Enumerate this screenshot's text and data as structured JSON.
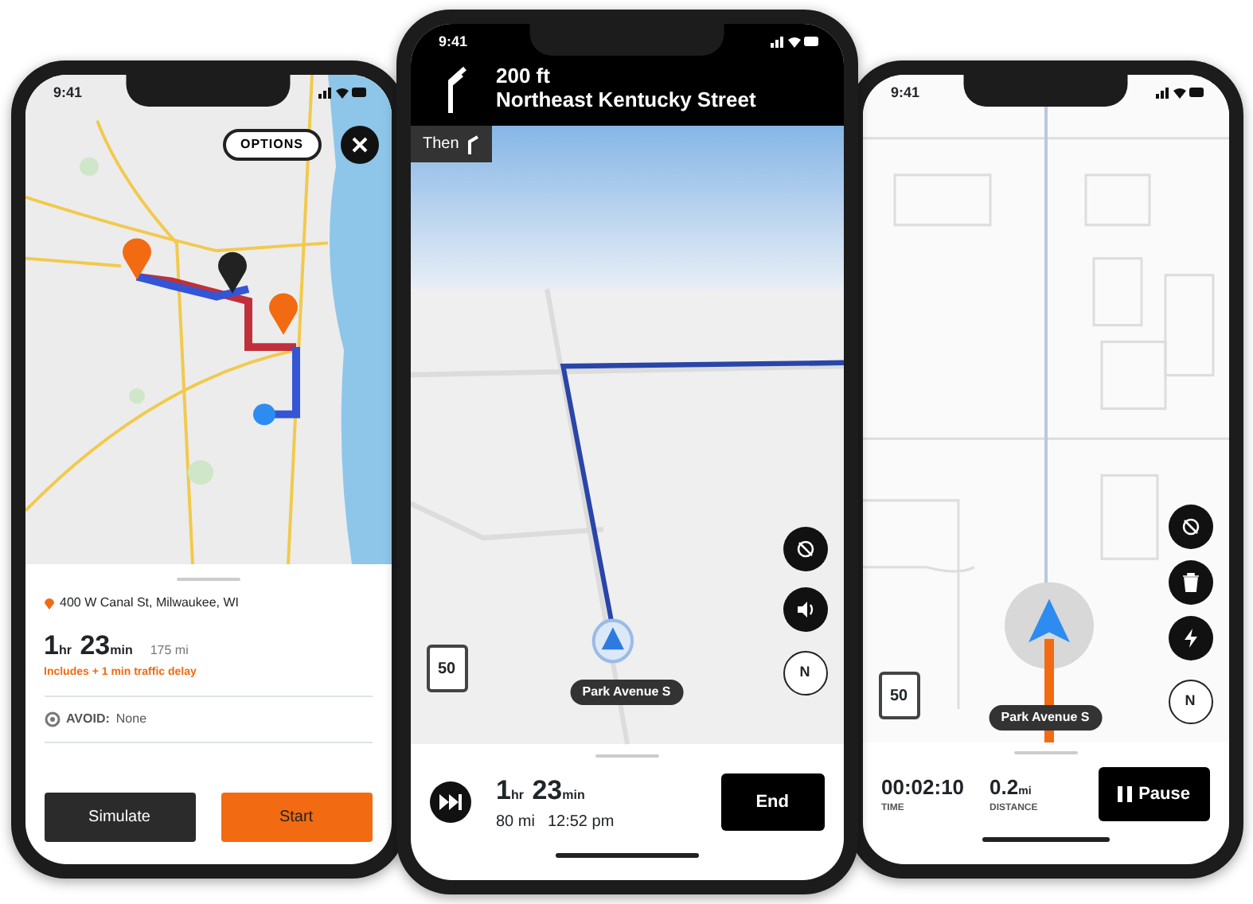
{
  "phones": [
    {
      "kind": "route_preview",
      "status_time": "9:41",
      "options_label": "OPTIONS",
      "address": "400 W Canal St, Milwaukee, WI",
      "duration": {
        "hours": "1",
        "hours_unit": "hr",
        "minutes": "23",
        "minutes_unit": "min"
      },
      "distance": "175 mi",
      "traffic_note": "Includes + 1 min traffic delay",
      "avoid_label": "AVOID:",
      "avoid_value": "None",
      "buttons": [
        "Simulate",
        "Start"
      ]
    },
    {
      "kind": "turn_by_turn",
      "status_time": "9:41",
      "maneuver_distance": "200 ft",
      "maneuver_street": "Northeast Kentucky Street",
      "then_label": "Then",
      "speed_limit": "50",
      "current_street": "Park Avenue S",
      "compass": "N",
      "duration": {
        "hours": "1",
        "hours_unit": "hr",
        "minutes": "23",
        "minutes_unit": "min"
      },
      "remaining_distance": "80 mi",
      "arrival_time": "12:52 pm",
      "end_button": "End"
    },
    {
      "kind": "simulation",
      "status_time": "9:41",
      "speed_limit": "50",
      "current_street": "Park Avenue S",
      "compass": "N",
      "elapsed_time": "00:02:10",
      "time_label": "TIME",
      "distance_value": "0.2",
      "distance_unit": "mi",
      "distance_label": "DISTANCE",
      "pause_button": "Pause"
    }
  ]
}
